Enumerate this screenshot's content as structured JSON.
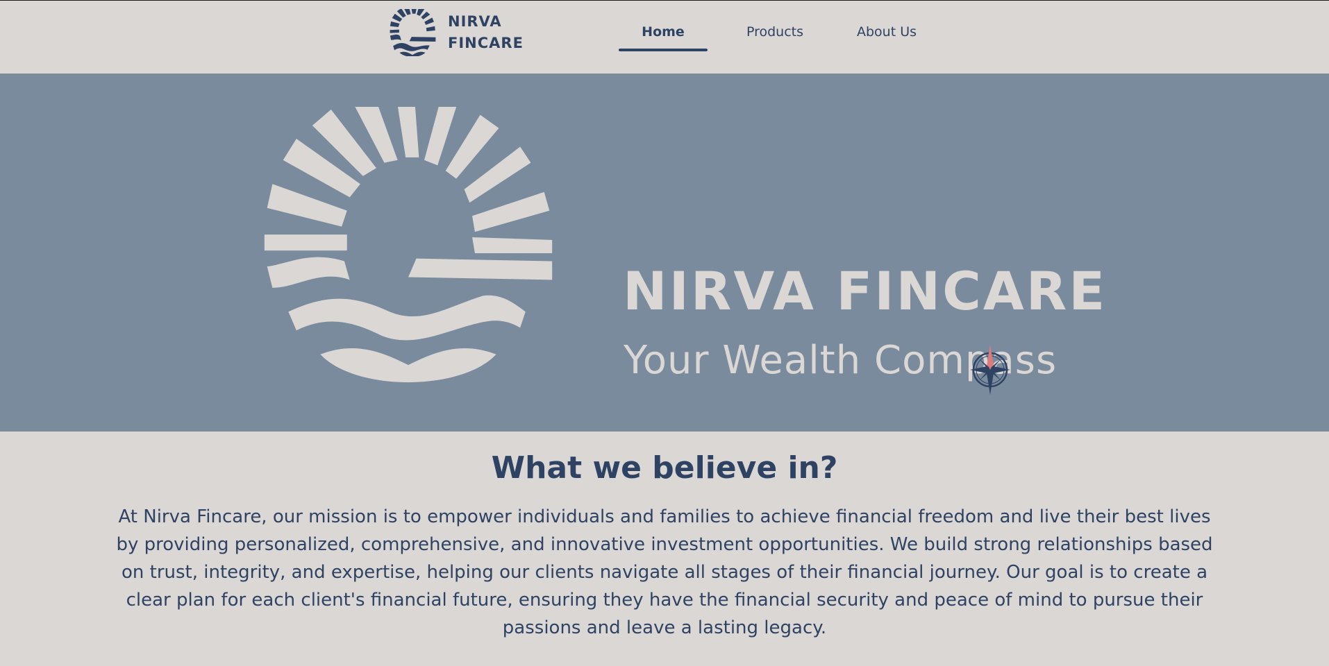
{
  "brand": {
    "name_line1": "NIRVA",
    "name_line2": "FINCARE",
    "logo_icon": "sun-over-waves-icon"
  },
  "nav": {
    "items": [
      {
        "label": "Home",
        "active": true
      },
      {
        "label": "Products",
        "active": false
      },
      {
        "label": "About Us",
        "active": false
      }
    ]
  },
  "hero": {
    "title": "NIRVA FINCARE",
    "subtitle": "Your Wealth Compass",
    "compass_icon": "compass-rose-icon"
  },
  "mission": {
    "title": "What we believe in?",
    "body": "At Nirva Fincare, our mission is to empower individuals and families to achieve financial freedom and live their best lives by providing personalized, comprehensive, and innovative investment opportunities. We build strong relationships based on trust, integrity, and expertise, helping our clients navigate all stages of their financial journey. Our goal is to create a clear plan for each client's financial future, ensuring they have the financial security and peace of mind to pursue their passions and leave a lasting legacy."
  },
  "colors": {
    "navy": "#2e4363",
    "background": "#dbd7d4",
    "hero_bg": "#7a8b9e",
    "compass_accent": "#e07a7a"
  }
}
